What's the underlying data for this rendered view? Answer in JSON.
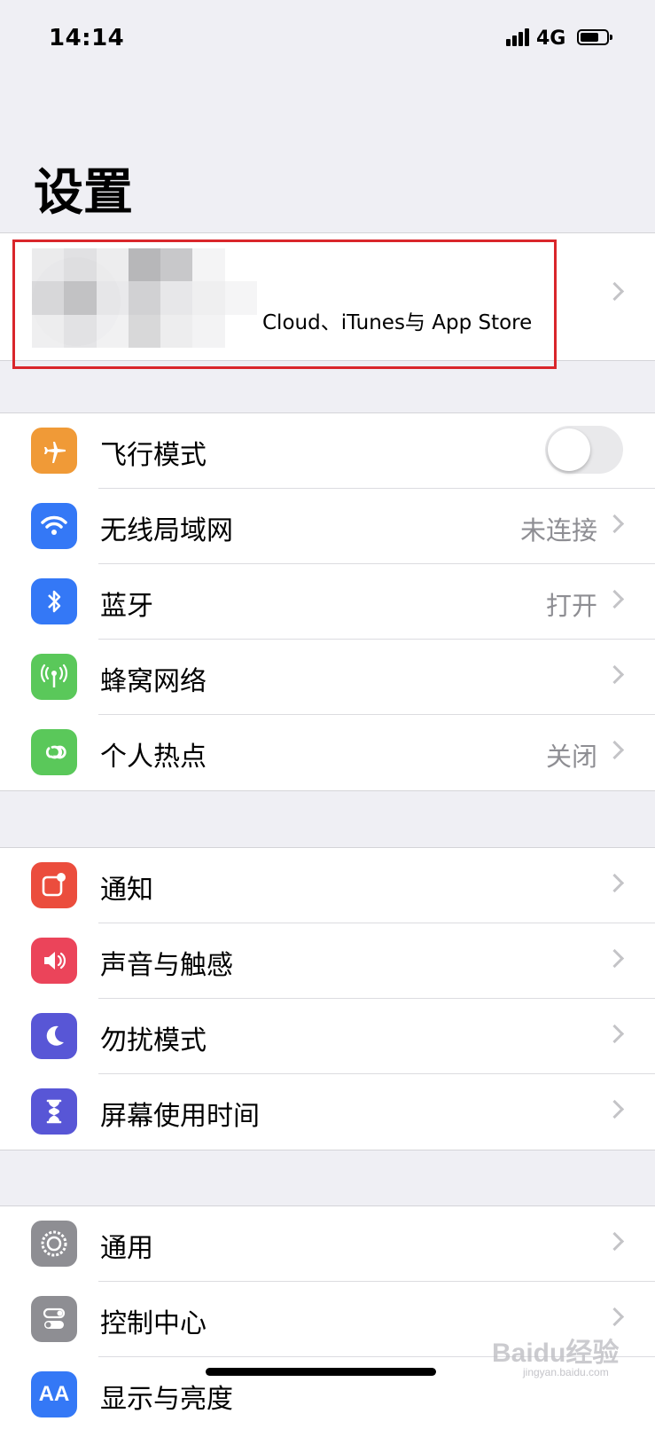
{
  "status_bar": {
    "time": "14:14",
    "network": "4G",
    "battery_level": 0.7
  },
  "page": {
    "title": "设置"
  },
  "profile": {
    "subtitle": "Cloud、iTunes与 App Store"
  },
  "groups": [
    {
      "rows": [
        {
          "label": "飞行模式",
          "value": "",
          "icon": "airplane-icon",
          "icon_color": "#f09a37",
          "toggle": false
        },
        {
          "label": "无线局域网",
          "value": "未连接",
          "icon": "wifi-icon",
          "icon_color": "#3478f6"
        },
        {
          "label": "蓝牙",
          "value": "打开",
          "icon": "bluetooth-icon",
          "icon_color": "#3478f6"
        },
        {
          "label": "蜂窝网络",
          "value": "",
          "icon": "cellular-icon",
          "icon_color": "#5ac85a"
        },
        {
          "label": "个人热点",
          "value": "关闭",
          "icon": "hotspot-icon",
          "icon_color": "#5ac85a"
        }
      ]
    },
    {
      "rows": [
        {
          "label": "通知",
          "value": "",
          "icon": "notifications-icon",
          "icon_color": "#eb4d3d"
        },
        {
          "label": "声音与触感",
          "value": "",
          "icon": "sound-icon",
          "icon_color": "#eb445a"
        },
        {
          "label": "勿扰模式",
          "value": "",
          "icon": "moon-icon",
          "icon_color": "#5856d6"
        },
        {
          "label": "屏幕使用时间",
          "value": "",
          "icon": "hourglass-icon",
          "icon_color": "#5856d6"
        }
      ]
    },
    {
      "rows": [
        {
          "label": "通用",
          "value": "",
          "icon": "gear-icon",
          "icon_color": "#8e8e93"
        },
        {
          "label": "控制中心",
          "value": "",
          "icon": "control-center-icon",
          "icon_color": "#8e8e93"
        },
        {
          "label": "显示与亮度",
          "value": "",
          "icon": "display-brightness-icon",
          "icon_color": "#3478f6"
        }
      ]
    }
  ],
  "watermark": {
    "text": "Baidu经验",
    "sub": "jingyan.baidu.com"
  }
}
